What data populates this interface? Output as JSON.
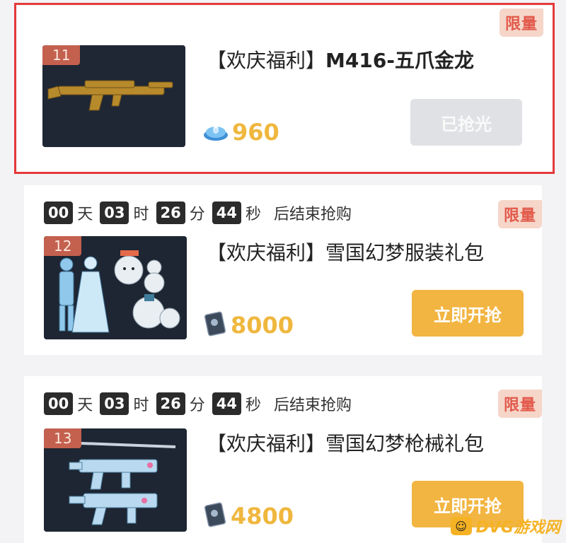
{
  "items": [
    {
      "badge": "限量",
      "number": "11",
      "title_prefix": "【欢庆福利】",
      "title_name": "M416-五爪金龙",
      "currency_icon": "coin-icon",
      "price": "960",
      "button_label": "已抢光",
      "button_state": "disabled"
    },
    {
      "badge": "限量",
      "countdown": {
        "days": "00",
        "days_unit": "天",
        "hours": "03",
        "hours_unit": "时",
        "minutes": "26",
        "minutes_unit": "分",
        "seconds": "44",
        "seconds_unit": "秒",
        "tail": "后结束抢购"
      },
      "number": "12",
      "title_prefix": "【欢庆福利】",
      "title_name": "雪国幻梦服装礼包",
      "currency_icon": "card-icon",
      "price": "8000",
      "button_label": "立即开抢",
      "button_state": "active"
    },
    {
      "badge": "限量",
      "countdown": {
        "days": "00",
        "days_unit": "天",
        "hours": "03",
        "hours_unit": "时",
        "minutes": "26",
        "minutes_unit": "分",
        "seconds": "44",
        "seconds_unit": "秒",
        "tail": "后结束抢购"
      },
      "number": "13",
      "title_prefix": "【欢庆福利】",
      "title_name": "雪国幻梦枪械礼包",
      "currency_icon": "card-icon",
      "price": "4800",
      "button_label": "立即开抢",
      "button_state": "active"
    }
  ],
  "colors": {
    "accent": "#f2b542",
    "price": "#efb73e",
    "badge_text": "#e2594b",
    "badge_bg": "#f5d6c9",
    "highlight": "#e43a3a",
    "disabled_button": "#dfe1e4"
  },
  "watermark": {
    "logo": "☺",
    "text": "DVG游戏网"
  }
}
